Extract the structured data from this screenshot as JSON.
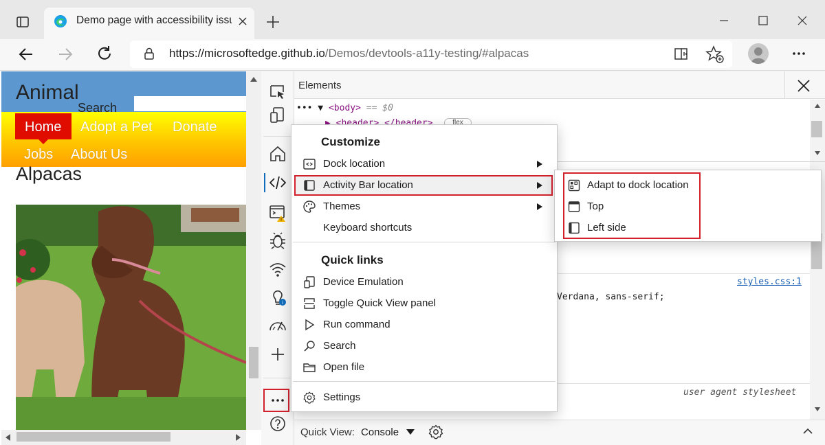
{
  "browser": {
    "tab_title": "Demo page with accessibility issues",
    "url_host": "https://microsoftedge.github.io",
    "url_path": "/Demos/devtools-a11y-testing/#alpacas"
  },
  "page": {
    "site_title": "Animal",
    "search_label": "Search",
    "nav": {
      "home": "Home",
      "adopt": "Adopt a Pet",
      "donate": "Donate",
      "jobs": "Jobs",
      "about": "About Us"
    },
    "heading": "Alpacas"
  },
  "devtools": {
    "panel_title": "Elements",
    "dom": {
      "line1_prefix": "••• ▼",
      "line1_tag": "<body>",
      "line1_suffix": " == $0",
      "line2_tag": "▶ <header>…</header>",
      "flex_badge": "flex"
    },
    "styles": {
      "source_link": "styles.css:1",
      "font_line": "Verdana, sans-serif;",
      "ua_stylesheet": "user agent stylesheet"
    },
    "quick_view": {
      "label": "Quick View:",
      "selected": "Console"
    },
    "activity_bar_icons": [
      "inspect-icon",
      "device-emulation-icon",
      "welcome-home-icon",
      "elements-icon",
      "console-icon",
      "sources-bug-icon",
      "network-icon",
      "issues-lightbulb-icon",
      "performance-icon",
      "more-tools-plus-icon",
      "more-options-icon",
      "help-icon"
    ]
  },
  "menu": {
    "customize_heading": "Customize",
    "items": {
      "dock_location": "Dock location",
      "activity_bar_location": "Activity Bar location",
      "themes": "Themes",
      "keyboard_shortcuts": "Keyboard shortcuts"
    },
    "quick_links_heading": "Quick links",
    "links": {
      "device_emulation": "Device Emulation",
      "toggle_quick_view": "Toggle Quick View panel",
      "run_command": "Run command",
      "search": "Search",
      "open_file": "Open file"
    },
    "settings": "Settings",
    "submenu": {
      "adapt": "Adapt to dock location",
      "top": "Top",
      "left_side": "Left side"
    }
  },
  "colors": {
    "highlight_red": "#d1202c",
    "accent_blue": "#0f6cbd",
    "nav_red": "#e10c00",
    "header_blue": "#5c98cf"
  }
}
